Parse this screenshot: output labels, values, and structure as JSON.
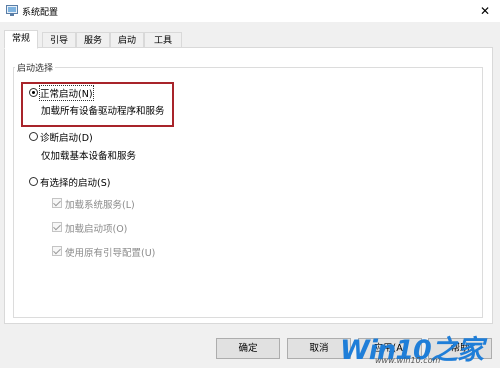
{
  "window": {
    "title": "系统配置",
    "close_glyph": "✕"
  },
  "tabs": [
    {
      "label": "常规",
      "active": true
    },
    {
      "label": "引导",
      "active": false
    },
    {
      "label": "服务",
      "active": false
    },
    {
      "label": "启动",
      "active": false
    },
    {
      "label": "工具",
      "active": false
    }
  ],
  "startup_group": {
    "legend": "启动选择",
    "options": [
      {
        "label": "正常启动(N)",
        "description": "加载所有设备驱动程序和服务",
        "selected": true
      },
      {
        "label": "诊断启动(D)",
        "description": "仅加载基本设备和服务",
        "selected": false
      },
      {
        "label": "有选择的启动(S)",
        "selected": false
      }
    ],
    "checkboxes": [
      {
        "label": "加载系统服务(L)",
        "checked": true,
        "enabled": false
      },
      {
        "label": "加载启动项(O)",
        "checked": true,
        "enabled": false
      },
      {
        "label": "使用原有引导配置(U)",
        "checked": true,
        "enabled": false
      }
    ]
  },
  "buttons": {
    "ok": "确定",
    "cancel": "取消",
    "apply": "应用(A)",
    "help": "帮助"
  },
  "watermark": {
    "brand": "Win10",
    "brand_zh": "之家",
    "url": "www.win10.com"
  },
  "colors": {
    "highlight": "#a8242a",
    "watermark": "#1f7ed8"
  }
}
